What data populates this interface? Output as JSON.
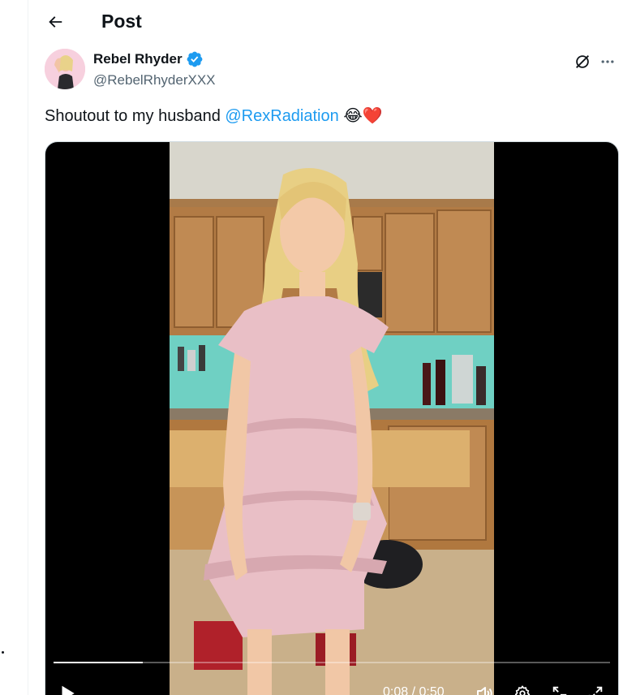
{
  "header": {
    "title": "Post",
    "back_icon": "arrow-left-icon"
  },
  "author": {
    "display_name": "Rebel Rhyder",
    "handle": "@RebelRhyderXXX",
    "verified": true,
    "verified_color": "#1d9bf0"
  },
  "post": {
    "text_before": "Shoutout to my husband ",
    "mention": "@RexRadiation",
    "emojis": "😂❤️"
  },
  "video": {
    "progress": 0.16,
    "time": "0:08 / 0:50"
  },
  "colors": {
    "accent": "#1d9bf0",
    "text": "#0f1419",
    "secondary": "#536471"
  }
}
